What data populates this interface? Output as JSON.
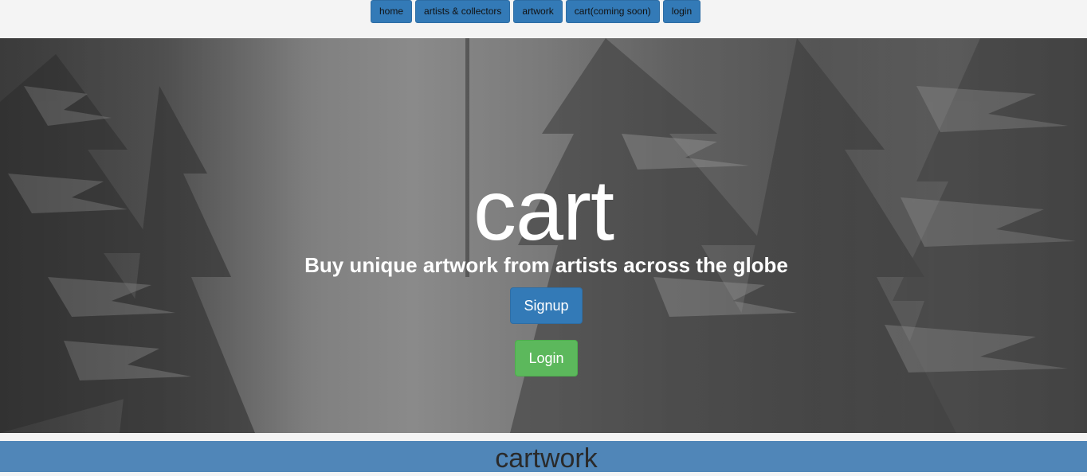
{
  "nav": {
    "items": [
      {
        "label": "home",
        "name": "nav-home-button"
      },
      {
        "label": "artists & collectors",
        "name": "nav-artists-collectors-button"
      },
      {
        "label": "artwork",
        "name": "nav-artwork-button"
      },
      {
        "label": "cart(coming soon)",
        "name": "nav-cart-button"
      },
      {
        "label": "login",
        "name": "nav-login-button"
      }
    ],
    "color": "#337ab7"
  },
  "hero": {
    "title": "cart",
    "subtitle": "Buy unique artwork from artists across the globe",
    "signup_label": "Signup",
    "login_label": "Login",
    "signup_color": "#337ab7",
    "login_color": "#5cb85c"
  },
  "footer": {
    "title": "cartwork",
    "band_color": "#5086b8"
  }
}
